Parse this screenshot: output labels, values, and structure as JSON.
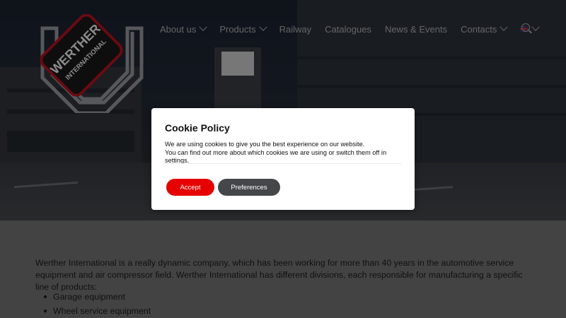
{
  "nav": {
    "items": [
      {
        "label": "About us",
        "dropdown": true
      },
      {
        "label": "Products",
        "dropdown": true
      },
      {
        "label": "Railway",
        "dropdown": false
      },
      {
        "label": "Catalogues",
        "dropdown": false
      },
      {
        "label": "News & Events",
        "dropdown": false
      },
      {
        "label": "Contacts",
        "dropdown": true
      }
    ],
    "language_icon": "uk-flag-icon",
    "search_icon": "search-icon"
  },
  "logo": {
    "line1": "WERTHER",
    "line2": "INTERNATIONAL"
  },
  "content": {
    "intro": "Werther International is a really dynamic company, which has been working for more than 40 years in the automotive service equipment and air compressor field. Werther International has different divisions, each responsible for manufacturing a specific line of products:",
    "list": [
      "Garage equipment",
      "Wheel service equipment"
    ]
  },
  "cookie": {
    "title": "Cookie Policy",
    "line1": "We are using cookies to give you the best experience on our website.",
    "line2_prefix": "You can find out more about which cookies we are using or switch them off in ",
    "line2_link": "settings",
    "line2_suffix": ".",
    "accept_label": "Accept",
    "preferences_label": "Preferences"
  },
  "colors": {
    "accent": "#e60000",
    "secondary_button": "#444649",
    "page_bg": "#7a7a7a"
  }
}
